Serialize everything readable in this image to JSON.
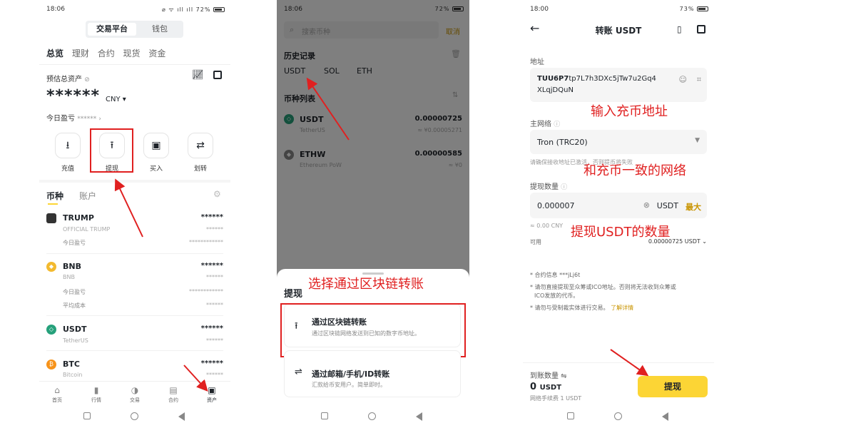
{
  "p1": {
    "time": "18:06",
    "status_icons": "⌀ ᯤ ıll ıll",
    "battery": "72%",
    "seg_active": "交易平台",
    "seg_other": "钱包",
    "tabs": [
      "总览",
      "理财",
      "合约",
      "现货",
      "资金"
    ],
    "est_label": "预估总资产",
    "masked_total": "******",
    "currency": "CNY ▾",
    "pnl_label": "今日盈亏",
    "pnl_value": "******",
    "actions": [
      "充值",
      "提现",
      "买入",
      "划转"
    ],
    "list_tab_active": "币种",
    "list_tab_other": "账户",
    "coins": [
      {
        "symbol": "TRUMP",
        "name": "OFFICIAL TRUMP",
        "value": "******",
        "value2": "******",
        "extra_label": "今日盈亏",
        "extra_value": "************"
      },
      {
        "symbol": "BNB",
        "name": "BNB",
        "value": "******",
        "value2": "******",
        "extra_label": "今日盈亏",
        "extra_value": "************",
        "extra2_label": "平均成本",
        "extra2_value": "******"
      },
      {
        "symbol": "USDT",
        "name": "TetherUS",
        "value": "******",
        "value2": "******"
      },
      {
        "symbol": "BTC",
        "name": "Bitcoin",
        "value": "******",
        "value2": "******"
      }
    ],
    "bottom_nav": [
      "首页",
      "行情",
      "交易",
      "合约",
      "资产"
    ]
  },
  "p2": {
    "time": "18:06",
    "battery": "72%",
    "search_placeholder": "搜索币种",
    "cancel": "取消",
    "history_title": "历史记录",
    "history": [
      "USDT",
      "SOL",
      "ETH"
    ],
    "list_title": "币种列表",
    "list": [
      {
        "symbol": "USDT",
        "name": "TetherUS",
        "amount": "0.00000725",
        "fiat": "≈ ¥0.00005271"
      },
      {
        "symbol": "ETHW",
        "name": "Ethereum PoW",
        "amount": "0.00000585",
        "fiat": "≈ ¥0"
      }
    ],
    "sheet_title": "提现",
    "opt1_title": "通过区块链转账",
    "opt1_desc": "通过区块链网络发送到已知的数字币地址。",
    "opt2_title": "通过邮箱/手机/ID转账",
    "opt2_desc": "汇款给币安用户。简单即时。"
  },
  "p3": {
    "time": "18:00",
    "battery": "73%",
    "title": "转账 USDT",
    "addr_label": "地址",
    "addr_bold": "TUU6P7",
    "addr_rest": "tp7L7h3DXc5jTw7u2Gq4",
    "addr_line2": "XLqjDQuN",
    "network_label": "主网络",
    "network_value": "Tron (TRC20)",
    "network_note": "请确保接收地址已激活，否则提币将失败",
    "amount_label": "提现数量",
    "amount_value": "0.000007",
    "amount_unit": "USDT",
    "max": "最大",
    "cny_est": "≈ 0.00 CNY",
    "available_label": "可用",
    "available_value": "0.00000725 USDT",
    "contract_info": "* 合约信息 ***jLj6t",
    "note1": "* 请勿直接提现至众筹或ICO地址。否则将无法收到众筹或",
    "note1b": "ICO发放的代币。",
    "note2": "* 请勿与受制裁实体进行交易。",
    "note2_link": "了解详情",
    "receive_label": "到账数量",
    "receive_value": "0",
    "receive_unit": "USDT",
    "fee": "网络手续费 1 USDT",
    "withdraw_button": "提现"
  },
  "annotations": {
    "a1": "选择通过区块链转账",
    "a2": "输入充币地址",
    "a3": "和充币一致的网络",
    "a4": "提现USDT的数量"
  },
  "colors": {
    "accent_yellow": "#fcd535",
    "annotation_red": "#e02020",
    "usdt_green": "#26a17b",
    "bnb_yellow": "#f3ba2f",
    "btc_orange": "#f7931a"
  }
}
